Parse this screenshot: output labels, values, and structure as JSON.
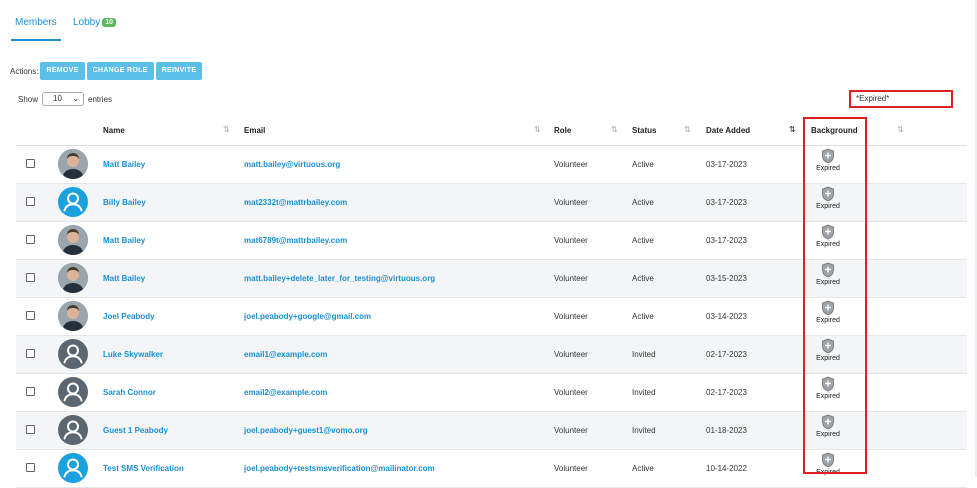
{
  "tabs": {
    "members": "Members",
    "lobby": "Lobby",
    "lobby_count": "10"
  },
  "actions": {
    "label": "Actions:",
    "remove": "REMOVE",
    "change_role": "CHANGE ROLE",
    "reinvite": "REINVITE"
  },
  "entries": {
    "show": "Show",
    "value": "10",
    "suffix": "entries"
  },
  "search": {
    "value": "*Expired*"
  },
  "columns": {
    "name": "Name",
    "email": "Email",
    "role": "Role",
    "status": "Status",
    "date_added": "Date Added",
    "background": "Background"
  },
  "rows": [
    {
      "name": "Matt Bailey",
      "email": "matt.bailey@virtuous.org",
      "role": "Volunteer",
      "status": "Active",
      "date": "03-17-2023",
      "background": "Expired",
      "avatar": "photo"
    },
    {
      "name": "Billy Bailey",
      "email": "mat2332t@mattrbailey.com",
      "role": "Volunteer",
      "status": "Active",
      "date": "03-17-2023",
      "background": "Expired",
      "avatar": "default-blue"
    },
    {
      "name": "Matt Bailey",
      "email": "mat6789t@mattrbailey.com",
      "role": "Volunteer",
      "status": "Active",
      "date": "03-17-2023",
      "background": "Expired",
      "avatar": "photo"
    },
    {
      "name": "Matt Bailey",
      "email": "matt.bailey+delete_later_for_testing@virtuous.org",
      "role": "Volunteer",
      "status": "Active",
      "date": "03-15-2023",
      "background": "Expired",
      "avatar": "photo"
    },
    {
      "name": "Joel Peabody",
      "email": "joel.peabody+google@gmail.com",
      "role": "Volunteer",
      "status": "Active",
      "date": "03-14-2023",
      "background": "Expired",
      "avatar": "photo"
    },
    {
      "name": "Luke Skywalker",
      "email": "email1@example.com",
      "role": "Volunteer",
      "status": "Invited",
      "date": "02-17-2023",
      "background": "Expired",
      "avatar": "default-dark"
    },
    {
      "name": "Sarah Connor",
      "email": "email2@example.com",
      "role": "Volunteer",
      "status": "Invited",
      "date": "02-17-2023",
      "background": "Expired",
      "avatar": "default-dark"
    },
    {
      "name": "Guest 1 Peabody",
      "email": "joel.peabody+guest1@vomo.org",
      "role": "Volunteer",
      "status": "Invited",
      "date": "01-18-2023",
      "background": "Expired",
      "avatar": "default-dark"
    },
    {
      "name": "Test SMS Verification",
      "email": "joel.peabody+testsmsverification@mailinator.com",
      "role": "Volunteer",
      "status": "Active",
      "date": "10-14-2022",
      "background": "Expired",
      "avatar": "default-blue"
    }
  ],
  "colors": {
    "accent": "#1a8fd1",
    "button": "#5bc0e8",
    "badge": "#5cb85c",
    "highlight": "#e02020"
  },
  "icons": {
    "sort": "sort-arrows-icon",
    "shield": "shield-plus-icon",
    "user": "user-icon",
    "chevron": "chevron-down-icon"
  }
}
